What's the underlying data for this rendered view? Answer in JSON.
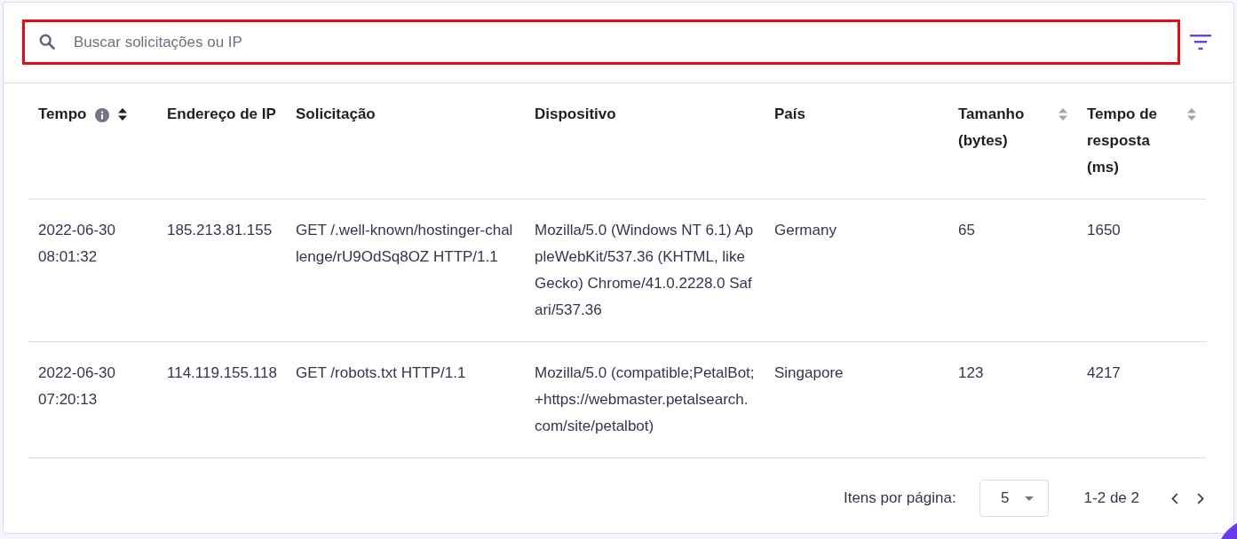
{
  "search": {
    "placeholder": "Buscar solicitações ou IP",
    "highlighted": true
  },
  "table": {
    "columns": [
      {
        "label": "Tempo",
        "info": true,
        "sortable": true,
        "sorted": true
      },
      {
        "label": "Endereço de IP",
        "info": false,
        "sortable": false,
        "sorted": false
      },
      {
        "label": "Solicitação",
        "info": false,
        "sortable": false,
        "sorted": false
      },
      {
        "label": "Dispositivo",
        "info": false,
        "sortable": false,
        "sorted": false
      },
      {
        "label": "País",
        "info": false,
        "sortable": false,
        "sorted": false
      },
      {
        "label": "Tamanho (bytes)",
        "info": false,
        "sortable": true,
        "sorted": false
      },
      {
        "label": "Tempo de resposta (ms)",
        "info": false,
        "sortable": true,
        "sorted": false
      }
    ],
    "rows": [
      {
        "cells": [
          "2022-06-30 08:01:32",
          "185.213.81.155",
          "GET /.well-known/hostinger-challenge/rU9OdSq8OZ HTTP/1.1",
          "Mozilla/5.0 (Windows NT 6.1) AppleWebKit/537.36 (KHTML, like Gecko) Chrome/41.0.2228.0 Safari/537.36",
          "Germany",
          "65",
          "1650"
        ]
      },
      {
        "cells": [
          "2022-06-30 07:20:13",
          "114.119.155.118",
          "GET /robots.txt HTTP/1.1",
          "Mozilla/5.0 (compatible;PetalBot;+https://webmaster.petalsearch.com/site/petalbot)",
          "Singapore",
          "123",
          "4217"
        ]
      }
    ]
  },
  "pagination": {
    "label": "Itens por página:",
    "page_size": "5",
    "range": "1-2 de 2"
  }
}
